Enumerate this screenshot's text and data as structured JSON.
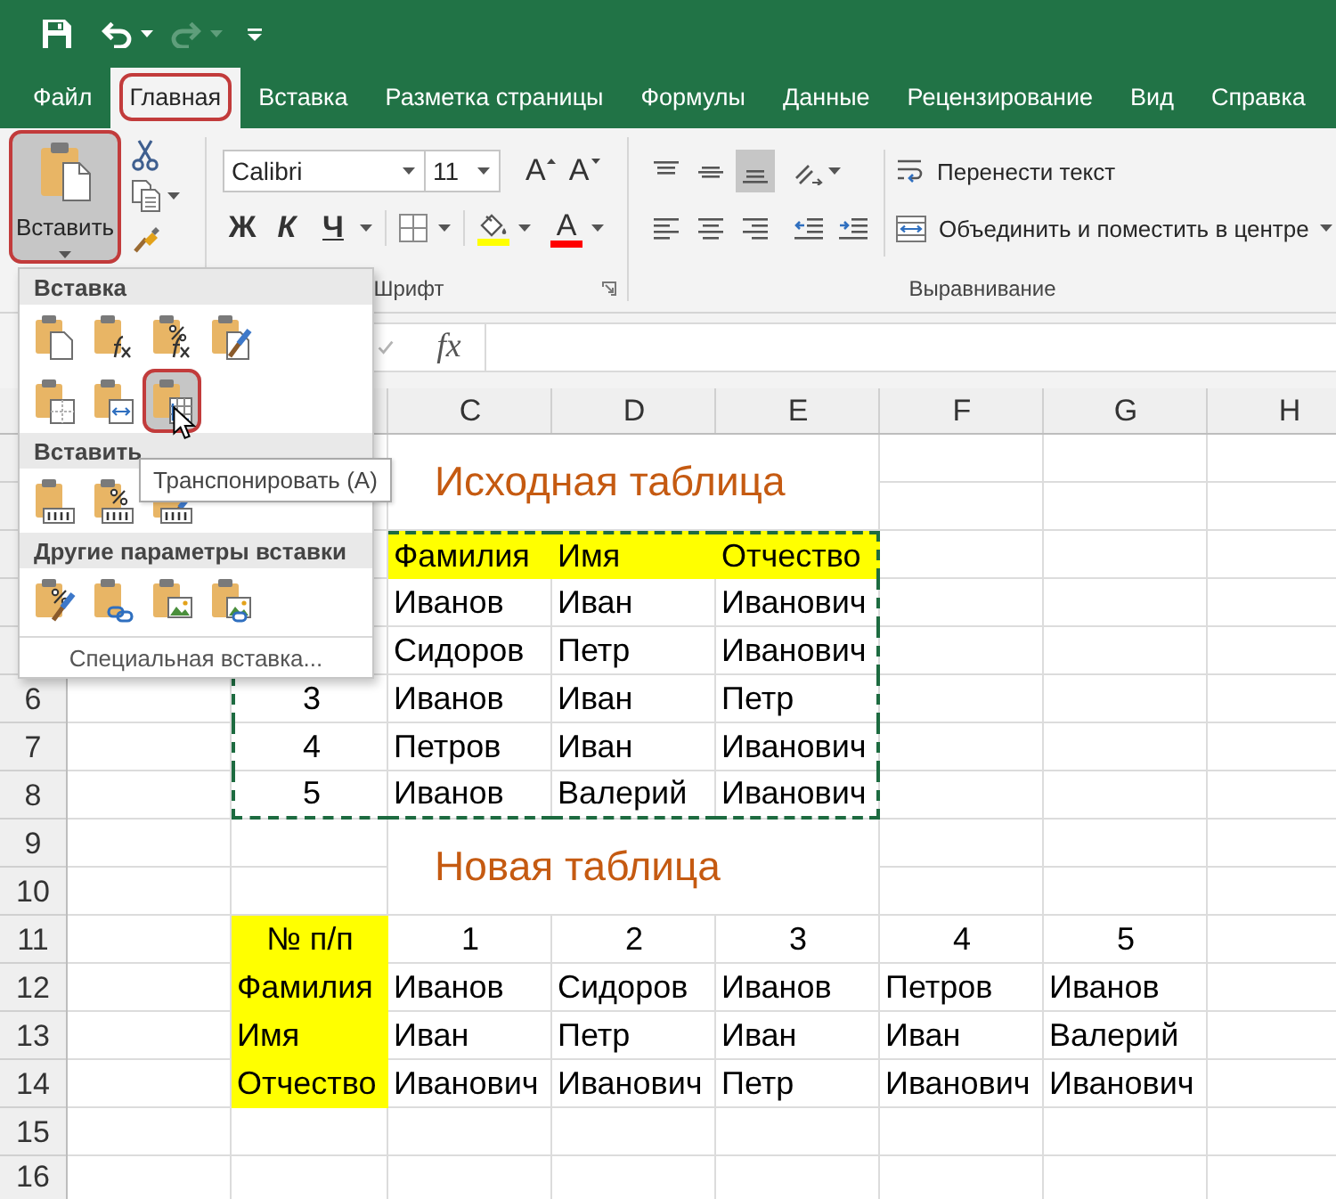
{
  "quick_access": [
    {
      "kind": "save",
      "disabled": false
    },
    {
      "kind": "undo",
      "disabled": false
    },
    {
      "kind": "redo",
      "disabled": true
    },
    {
      "kind": "customize",
      "disabled": false
    }
  ],
  "tabs": [
    {
      "label": "Файл",
      "selected": false,
      "circled": false
    },
    {
      "label": "Главная",
      "selected": true,
      "circled": true
    },
    {
      "label": "Вставка",
      "selected": false,
      "circled": false
    },
    {
      "label": "Разметка страницы",
      "selected": false,
      "circled": false
    },
    {
      "label": "Формулы",
      "selected": false,
      "circled": false
    },
    {
      "label": "Данные",
      "selected": false,
      "circled": false
    },
    {
      "label": "Рецензирование",
      "selected": false,
      "circled": false
    },
    {
      "label": "Вид",
      "selected": false,
      "circled": false
    },
    {
      "label": "Справка",
      "selected": false,
      "circled": false
    }
  ],
  "ribbon": {
    "clipboard": {
      "paste": {
        "label": "Вставить",
        "pressed": true,
        "circled": true
      },
      "tools": [
        {
          "kind": "cut"
        },
        {
          "kind": "copy"
        },
        {
          "kind": "format_painter"
        }
      ]
    },
    "font": {
      "title": "Шрифт",
      "name": "Calibri",
      "size": "11",
      "size_buttons": [
        {
          "kind": "grow",
          "label": "A"
        },
        {
          "kind": "shrink",
          "label": "A"
        }
      ],
      "style_buttons": [
        {
          "kind": "bold",
          "label": "Ж"
        },
        {
          "kind": "italic",
          "label": "К"
        },
        {
          "kind": "underline",
          "label": "Ч"
        }
      ],
      "color_buttons": [
        {
          "kind": "fill",
          "color": "#ffff00"
        },
        {
          "kind": "font",
          "label": "A",
          "color": "#ff0000"
        }
      ]
    },
    "alignment": {
      "title": "Выравнивание",
      "vertical": [
        {
          "kind": "top",
          "selected": false
        },
        {
          "kind": "middle",
          "selected": false
        },
        {
          "kind": "bottom",
          "selected": true
        }
      ],
      "horizontal": [
        {
          "kind": "left",
          "selected": false
        },
        {
          "kind": "center",
          "selected": false
        },
        {
          "kind": "right",
          "selected": false
        }
      ],
      "wrap_text": "Перенести текст",
      "merge": "Объединить и поместить в центре"
    }
  },
  "formula_bar": {
    "function_button": "fx"
  },
  "sheet": {
    "columns": [
      "C",
      "D",
      "E",
      "F",
      "G",
      "H"
    ],
    "row_numbers": [
      "6",
      "7",
      "8",
      "9",
      "10",
      "11",
      "12",
      "13",
      "14",
      "15",
      "16"
    ],
    "source_table": {
      "title": "Исходная таблица",
      "header": [
        "Фамилия",
        "Имя",
        "Отчество"
      ],
      "rows": [
        {
          "cells": [
            "Иванов",
            "Иван",
            "Иванович"
          ]
        },
        {
          "cells": [
            "Сидоров",
            "Петр",
            "Иванович"
          ]
        },
        {
          "number": "3",
          "cells": [
            "Иванов",
            "Иван",
            "Петр"
          ]
        },
        {
          "number": "4",
          "cells": [
            "Петров",
            "Иван",
            "Иванович"
          ]
        },
        {
          "number": "5",
          "cells": [
            "Иванов",
            "Валерий",
            "Иванович"
          ]
        }
      ]
    },
    "new_table": {
      "title": "Новая таблица",
      "rows": [
        {
          "kind": "numbering",
          "label": "№ п/п",
          "cells": [
            "1",
            "2",
            "3",
            "4",
            "5"
          ]
        },
        {
          "kind": "field",
          "label": "Фамилия",
          "cells": [
            "Иванов",
            "Сидоров",
            "Иванов",
            "Петров",
            "Иванов"
          ]
        },
        {
          "kind": "field",
          "label": "Имя",
          "cells": [
            "Иван",
            "Петр",
            "Иван",
            "Иван",
            "Валерий"
          ]
        },
        {
          "kind": "field",
          "label": "Отчество",
          "cells": [
            "Иванович",
            "Иванович",
            "Петр",
            "Иванович",
            "Иванович"
          ]
        }
      ]
    }
  },
  "paste_menu": {
    "sections": [
      {
        "title": "Вставка",
        "options": [
          {
            "kind": "paste",
            "selected": false,
            "circled": false
          },
          {
            "kind": "formulas",
            "selected": false,
            "circled": false
          },
          {
            "kind": "formulas_number_format",
            "selected": false,
            "circled": false
          },
          {
            "kind": "keep_source_format",
            "selected": false,
            "circled": false
          },
          {
            "kind": "no_borders",
            "selected": false,
            "circled": false
          },
          {
            "kind": "keep_column_widths",
            "selected": false,
            "circled": false
          },
          {
            "kind": "transpose",
            "selected": true,
            "circled": true
          }
        ]
      },
      {
        "title": "Вставить",
        "options": [
          {
            "kind": "values",
            "selected": false,
            "circled": false
          },
          {
            "kind": "values_number_format",
            "selected": false,
            "circled": false
          },
          {
            "kind": "values_source_format",
            "selected": false,
            "circled": false
          }
        ]
      },
      {
        "title": "Другие параметры вставки",
        "options": [
          {
            "kind": "formatting",
            "selected": false,
            "circled": false
          },
          {
            "kind": "link",
            "selected": false,
            "circled": false
          },
          {
            "kind": "picture",
            "selected": false,
            "circled": false
          },
          {
            "kind": "linked_picture",
            "selected": false,
            "circled": false
          }
        ]
      }
    ],
    "footer": "Специальная вставка...",
    "tooltip": "Транспонировать (А)"
  }
}
